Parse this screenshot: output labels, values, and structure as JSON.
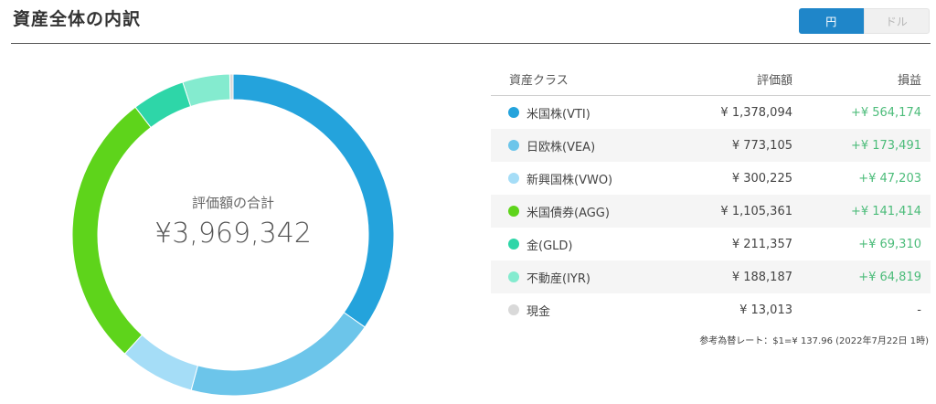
{
  "header": {
    "title": "資産全体の内訳",
    "currency_toggle": {
      "active": "円",
      "inactive": "ドル"
    }
  },
  "donut": {
    "center_label": "評価額の合計",
    "total": "¥3,969,342"
  },
  "table": {
    "columns": [
      "資産クラス",
      "評価額",
      "損益"
    ],
    "rows": [
      {
        "name": "米国株(VTI)",
        "value": "¥ 1,378,094",
        "pl": "+¥ 564,174",
        "color": "#24a3dc",
        "amount": 1378094
      },
      {
        "name": "日欧株(VEA)",
        "value": "¥ 773,105",
        "pl": "+¥ 173,491",
        "color": "#6cc5ea",
        "amount": 773105
      },
      {
        "name": "新興国株(VWO)",
        "value": "¥ 300,225",
        "pl": "+¥ 47,203",
        "color": "#a5ddf7",
        "amount": 300225
      },
      {
        "name": "米国債券(AGG)",
        "value": "¥ 1,105,361",
        "pl": "+¥ 141,414",
        "color": "#5ed41b",
        "amount": 1105361
      },
      {
        "name": "金(GLD)",
        "value": "¥ 211,357",
        "pl": "+¥ 69,310",
        "color": "#2ed6a8",
        "amount": 211357
      },
      {
        "name": "不動産(IYR)",
        "value": "¥ 188,187",
        "pl": "+¥ 64,819",
        "color": "#84ebcf",
        "amount": 188187
      },
      {
        "name": "現金",
        "value": "¥ 13,013",
        "pl": "-",
        "color": "#d9d9d9",
        "amount": 13013
      }
    ]
  },
  "footnote": "参考為替レート：$1=¥ 137.96 (2022年7月22日 1時)"
}
